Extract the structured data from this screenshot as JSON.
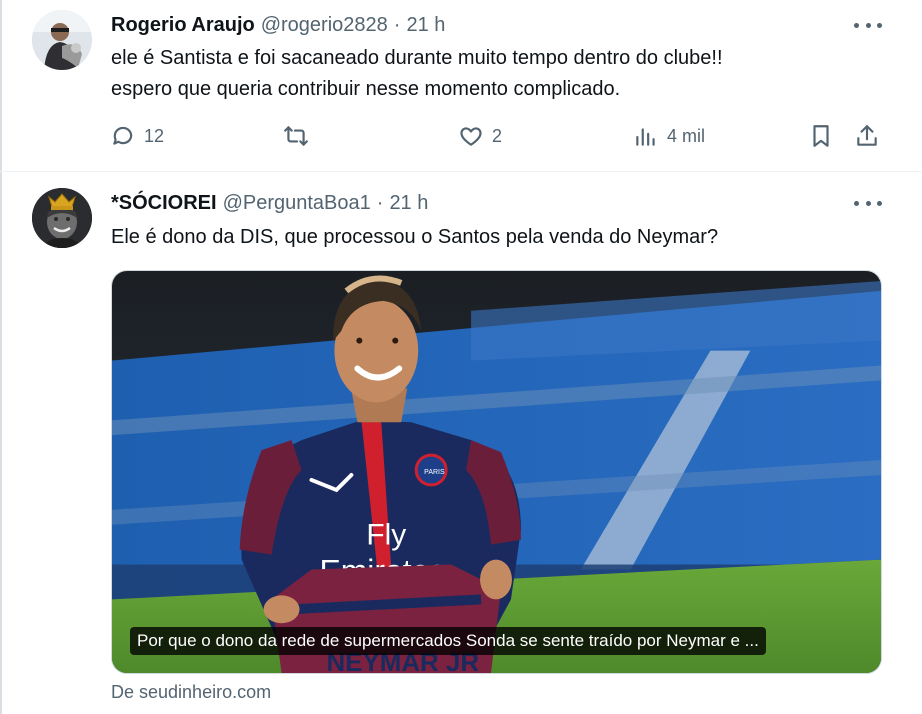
{
  "tweets": [
    {
      "display_name": "Rogerio Araujo",
      "handle": "@rogerio2828",
      "separator": "·",
      "time": "21 h",
      "text_lines": [
        "ele é Santista e foi sacaneado durante muito tempo dentro do clube!!",
        "espero que queria contribuir nesse momento complicado."
      ],
      "replies": "12",
      "retweets": "",
      "likes": "2",
      "views": "4 mil"
    },
    {
      "display_name": "*SÓCIOREI",
      "handle": "@PerguntaBoa1",
      "separator": "·",
      "time": "21 h",
      "text_lines": [
        "Ele é dono da DIS, que processou o Santos pela venda do Neymar?"
      ],
      "link_card": {
        "caption": "Por que o dono da rede de supermercados Sonda se sente traído por Neymar e ...",
        "source": "De seudinheiro.com",
        "jersey_sponsor_line1": "Fly",
        "jersey_sponsor_line2": "Emirates",
        "shirt_name": "NEYMAR JR",
        "badge_text": "PARIS"
      }
    }
  ],
  "colors": {
    "text_primary": "#0f1419",
    "text_secondary": "#536471",
    "divider": "#eff3f4"
  },
  "icons": [
    "more-icon",
    "reply-icon",
    "retweet-icon",
    "like-icon",
    "views-icon",
    "bookmark-icon",
    "share-icon"
  ]
}
